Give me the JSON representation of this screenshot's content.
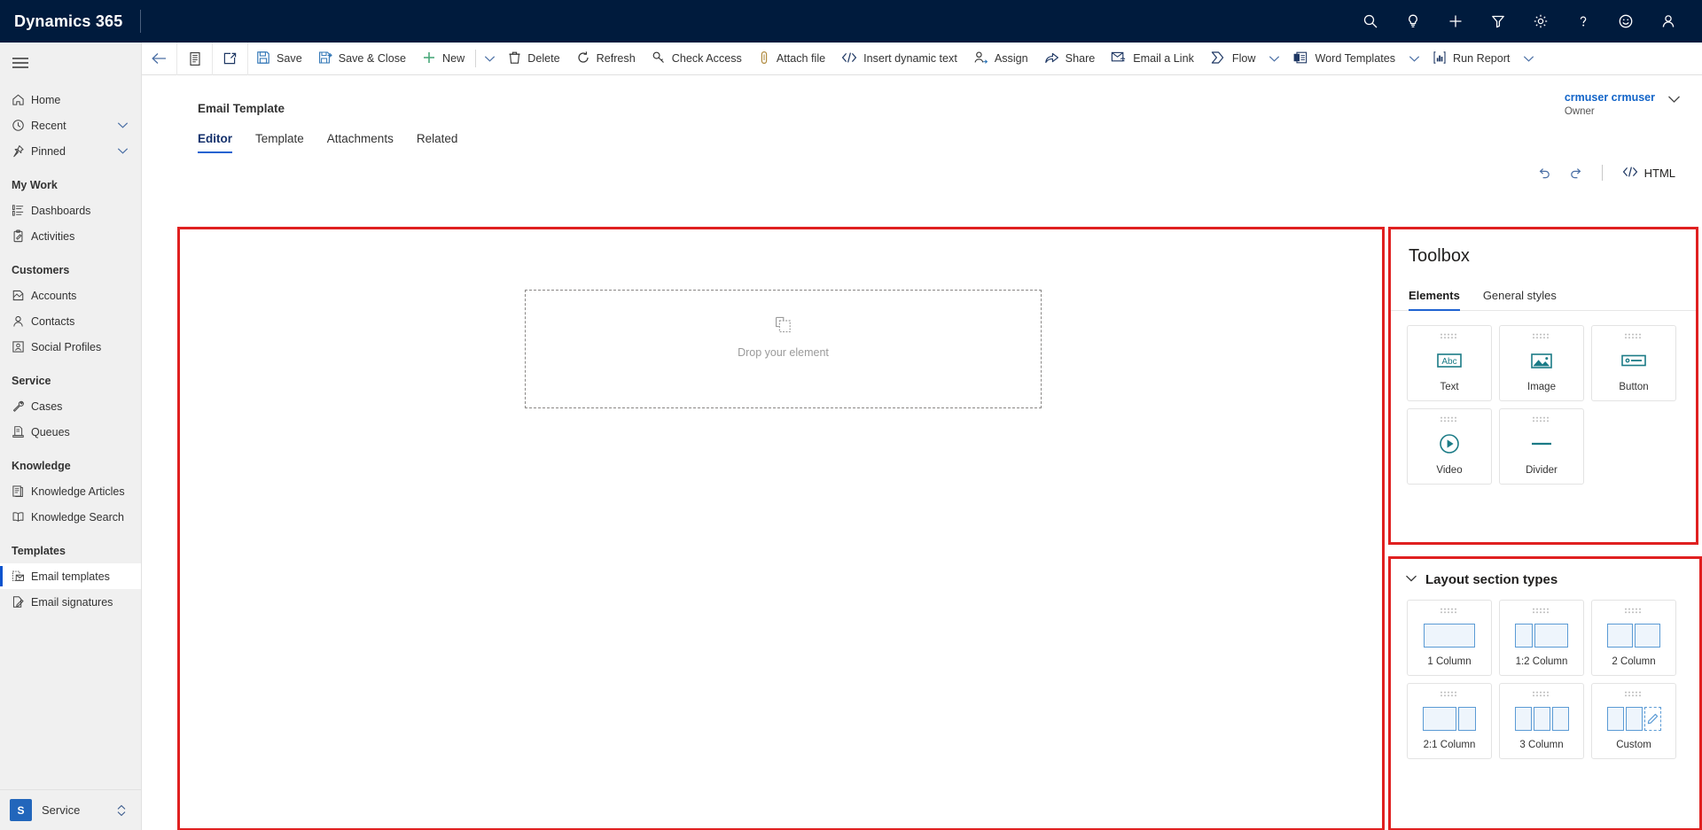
{
  "header": {
    "brand": "Dynamics 365",
    "icons": [
      {
        "name": "search-icon",
        "label": "Search"
      },
      {
        "name": "lightbulb-icon",
        "label": "Ideas"
      },
      {
        "name": "plus-icon",
        "label": "Quick create"
      },
      {
        "name": "filter-icon",
        "label": "Filter"
      },
      {
        "name": "gear-icon",
        "label": "Settings"
      },
      {
        "name": "question-icon",
        "label": "Help"
      },
      {
        "name": "smiley-icon",
        "label": "Feedback"
      },
      {
        "name": "person-icon",
        "label": "Account manager"
      }
    ]
  },
  "sidebar": {
    "hamburger_label": "Site map",
    "items": [
      {
        "label": "Home",
        "icon": "home-icon",
        "type": "item",
        "chevron": false,
        "active": false
      },
      {
        "label": "Recent",
        "icon": "clock-icon",
        "type": "item",
        "chevron": true,
        "active": false
      },
      {
        "label": "Pinned",
        "icon": "pin-icon",
        "type": "item",
        "chevron": true,
        "active": false
      },
      {
        "label": "My Work",
        "type": "group"
      },
      {
        "label": "Dashboards",
        "icon": "dashboard-icon",
        "type": "item",
        "chevron": false,
        "active": false
      },
      {
        "label": "Activities",
        "icon": "activities-icon",
        "type": "item",
        "chevron": false,
        "active": false
      },
      {
        "label": "Customers",
        "type": "group"
      },
      {
        "label": "Accounts",
        "icon": "accounts-icon",
        "type": "item",
        "chevron": false,
        "active": false
      },
      {
        "label": "Contacts",
        "icon": "contacts-icon",
        "type": "item",
        "chevron": false,
        "active": false
      },
      {
        "label": "Social Profiles",
        "icon": "social-profiles-icon",
        "type": "item",
        "chevron": false,
        "active": false
      },
      {
        "label": "Service",
        "type": "group"
      },
      {
        "label": "Cases",
        "icon": "cases-icon",
        "type": "item",
        "chevron": false,
        "active": false
      },
      {
        "label": "Queues",
        "icon": "queues-icon",
        "type": "item",
        "chevron": false,
        "active": false
      },
      {
        "label": "Knowledge",
        "type": "group"
      },
      {
        "label": "Knowledge Articles",
        "icon": "knowledge-articles-icon",
        "type": "item",
        "chevron": false,
        "active": false
      },
      {
        "label": "Knowledge Search",
        "icon": "knowledge-search-icon",
        "type": "item",
        "chevron": false,
        "active": false
      },
      {
        "label": "Templates",
        "type": "group"
      },
      {
        "label": "Email templates",
        "icon": "email-template-icon",
        "type": "item",
        "chevron": false,
        "active": true
      },
      {
        "label": "Email signatures",
        "icon": "email-signature-icon",
        "type": "item",
        "chevron": false,
        "active": false
      }
    ],
    "app_switcher": {
      "badge": "S",
      "name": "Service"
    }
  },
  "command_bar": {
    "back_label": "Back",
    "form_selector_label": "Form selector",
    "popout_label": "Open in new window",
    "buttons": [
      {
        "label": "Save",
        "icon": "save-icon"
      },
      {
        "label": "Save & Close",
        "icon": "save-close-icon"
      },
      {
        "label": "New",
        "icon": "plus-icon"
      },
      {
        "label": "Delete",
        "icon": "trash-icon"
      },
      {
        "label": "Refresh",
        "icon": "refresh-icon"
      },
      {
        "label": "Check Access",
        "icon": "key-icon"
      },
      {
        "label": "Attach file",
        "icon": "paperclip-icon"
      },
      {
        "label": "Insert dynamic text",
        "icon": "code-icon"
      },
      {
        "label": "Assign",
        "icon": "assign-user-icon"
      },
      {
        "label": "Share",
        "icon": "share-icon"
      },
      {
        "label": "Email a Link",
        "icon": "email-link-icon"
      },
      {
        "label": "Flow",
        "icon": "flow-icon",
        "caret": true
      },
      {
        "label": "Word Templates",
        "icon": "word-template-icon",
        "caret": true
      },
      {
        "label": "Run Report",
        "icon": "run-report-icon",
        "caret": true
      }
    ]
  },
  "record": {
    "title": "Email Template",
    "owner_name": "crmuser crmuser",
    "owner_role": "Owner",
    "tabs": [
      {
        "label": "Editor",
        "active": true
      },
      {
        "label": "Template",
        "active": false
      },
      {
        "label": "Attachments",
        "active": false
      },
      {
        "label": "Related",
        "active": false
      }
    ]
  },
  "editor_toolbar": {
    "undo_label": "Undo",
    "redo_label": "Redo",
    "html_label": "HTML"
  },
  "canvas": {
    "dropzone_label": "Drop your element",
    "dropzone_icon": "drop-element-icon"
  },
  "toolbox": {
    "title": "Toolbox",
    "tabs": [
      {
        "label": "Elements",
        "active": true
      },
      {
        "label": "General styles",
        "active": false
      }
    ],
    "elements": [
      {
        "label": "Text",
        "icon": "text-abc-icon"
      },
      {
        "label": "Image",
        "icon": "image-icon"
      },
      {
        "label": "Button",
        "icon": "button-icon"
      },
      {
        "label": "Video",
        "icon": "video-play-icon"
      },
      {
        "label": "Divider",
        "icon": "divider-icon"
      }
    ]
  },
  "layout_section": {
    "title": "Layout section types",
    "expanded": true,
    "items": [
      {
        "label": "1 Column",
        "cols": [
          58
        ],
        "custom": false
      },
      {
        "label": "1:2 Column",
        "cols": [
          20,
          38
        ],
        "custom": false
      },
      {
        "label": "2 Column",
        "cols": [
          29,
          29
        ],
        "custom": false
      },
      {
        "label": "2:1 Column",
        "cols": [
          38,
          20
        ],
        "custom": false
      },
      {
        "label": "3 Column",
        "cols": [
          19,
          19,
          19
        ],
        "custom": false
      },
      {
        "label": "Custom",
        "cols": [
          19,
          19
        ],
        "custom": true
      }
    ]
  },
  "colors": {
    "header_bg": "#001b3d",
    "accent_blue": "#1f63d1",
    "highlight_red": "#e02020",
    "tile_icon_teal": "#1b7b86",
    "layout_col_blue": "#5b9bd5"
  }
}
